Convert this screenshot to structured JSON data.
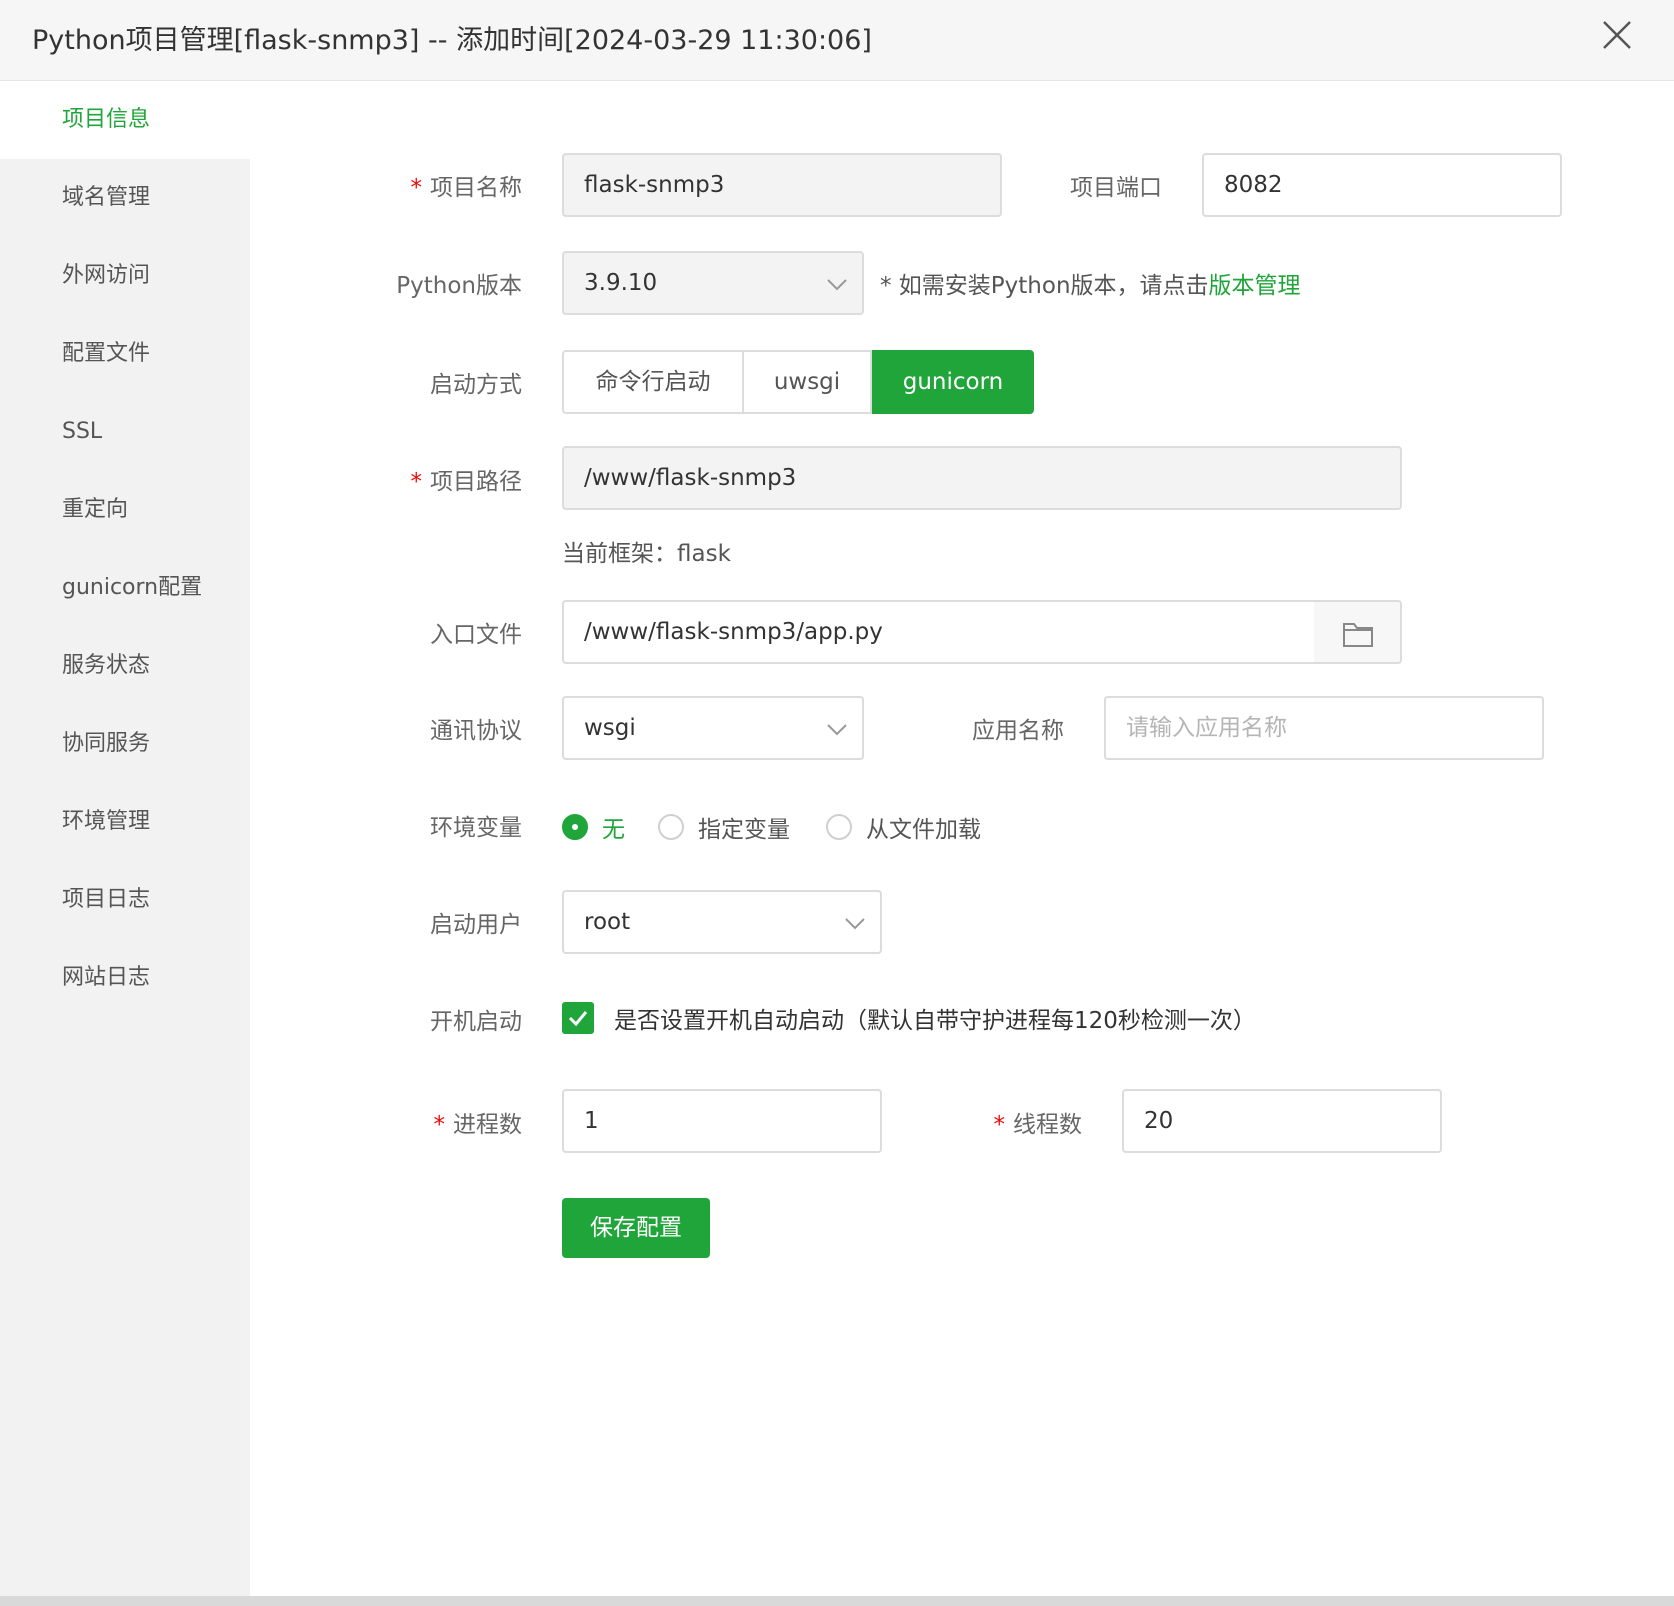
{
  "dialog": {
    "title": "Python项目管理[flask-snmp3] -- 添加时间[2024-03-29 11:30:06]"
  },
  "sidebar": {
    "items": [
      {
        "label": "项目信息"
      },
      {
        "label": "域名管理"
      },
      {
        "label": "外网访问"
      },
      {
        "label": "配置文件"
      },
      {
        "label": "SSL"
      },
      {
        "label": "重定向"
      },
      {
        "label": "gunicorn配置"
      },
      {
        "label": "服务状态"
      },
      {
        "label": "协同服务"
      },
      {
        "label": "环境管理"
      },
      {
        "label": "项目日志"
      },
      {
        "label": "网站日志"
      }
    ],
    "active_index": 0
  },
  "form": {
    "project_name": {
      "label": "项目名称",
      "value": "flask-snmp3"
    },
    "project_port": {
      "label": "项目端口",
      "value": "8082"
    },
    "python_version": {
      "label": "Python版本",
      "value": "3.9.10",
      "hint": "* 如需安装Python版本，请点击",
      "hint_link": "版本管理"
    },
    "start_method": {
      "label": "启动方式",
      "options": [
        "命令行启动",
        "uwsgi",
        "gunicorn"
      ],
      "selected": "gunicorn"
    },
    "project_path": {
      "label": "项目路径",
      "value": "/www/flask-snmp3",
      "framework_note": "当前框架：flask"
    },
    "entry_file": {
      "label": "入口文件",
      "value": "/www/flask-snmp3/app.py"
    },
    "protocol": {
      "label": "通讯协议",
      "value": "wsgi"
    },
    "app_name": {
      "label": "应用名称",
      "placeholder": "请输入应用名称",
      "value": ""
    },
    "env_vars": {
      "label": "环境变量",
      "options": [
        "无",
        "指定变量",
        "从文件加载"
      ],
      "selected": "无"
    },
    "run_user": {
      "label": "启动用户",
      "value": "root"
    },
    "autostart": {
      "label": "开机启动",
      "text": "是否设置开机自动启动（默认自带守护进程每120秒检测一次）",
      "checked": true
    },
    "processes": {
      "label": "进程数",
      "value": "1"
    },
    "threads": {
      "label": "线程数",
      "value": "20"
    },
    "save_label": "保存配置"
  },
  "colors": {
    "accent": "#20a53a",
    "required": "#ef0808",
    "sidebar_bg": "#f2f2f2"
  }
}
